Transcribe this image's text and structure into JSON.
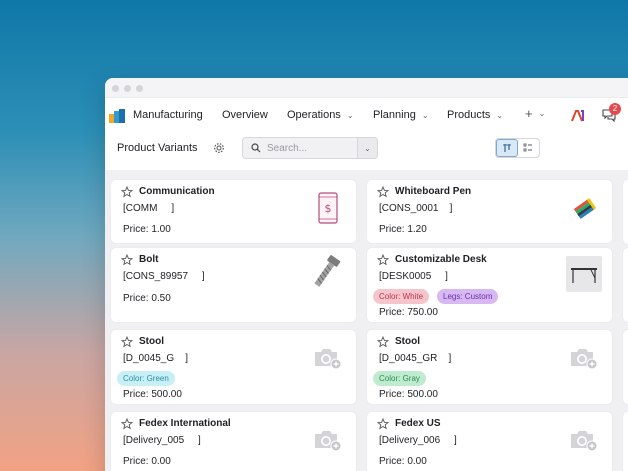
{
  "navbar": {
    "app_name": "Manufacturing",
    "items": [
      {
        "label": "Overview"
      },
      {
        "label": "Operations"
      },
      {
        "label": "Planning"
      },
      {
        "label": "Products"
      }
    ],
    "add_label": "+",
    "notification_count": "2"
  },
  "control": {
    "title": "Product Variants",
    "search_placeholder": "Search..."
  },
  "cards": [
    {
      "name": "Communication",
      "code": "[COMM     ]",
      "price": "Price: 1.00",
      "icon": "mobile-payment-icon"
    },
    {
      "name": "Whiteboard Pen",
      "code": "[CONS_0001    ]",
      "price": "Price: 1.20",
      "icon": "markers-icon"
    },
    {
      "name": "Bolt",
      "code": "[CONS_89957     ]",
      "price": "Price: 0.50",
      "icon": "bolt-icon"
    },
    {
      "name": "Customizable Desk",
      "code": "[DESK0005     ]",
      "price": "Price: 750.00",
      "icon": "desk-icon",
      "tags": [
        {
          "label": "Color: White",
          "color": "#f6c5cc",
          "text": "#b8384f"
        },
        {
          "label": "Legs: Custom",
          "color": "#d7b8f2",
          "text": "#6a2fa0"
        }
      ]
    },
    {
      "name": "Stool",
      "code": "[D_0045_G    ]",
      "price": "Price: 500.00",
      "icon": "camera-placeholder-icon",
      "tags": [
        {
          "label": "Color: Green",
          "color": "#c8eff5",
          "text": "#2a8fa0"
        }
      ]
    },
    {
      "name": "Stool",
      "code": "[D_0045_GR    ]",
      "price": "Price: 500.00",
      "icon": "camera-placeholder-icon",
      "tags": [
        {
          "label": "Color: Gray",
          "color": "#bfeccf",
          "text": "#2a8a55"
        }
      ]
    },
    {
      "name": "Fedex International",
      "code": "[Delivery_005     ]",
      "price": "Price: 0.00",
      "icon": "camera-placeholder-icon"
    },
    {
      "name": "Fedex US",
      "code": "[Delivery_006     ]",
      "price": "Price: 0.00",
      "icon": "camera-placeholder-icon"
    }
  ]
}
